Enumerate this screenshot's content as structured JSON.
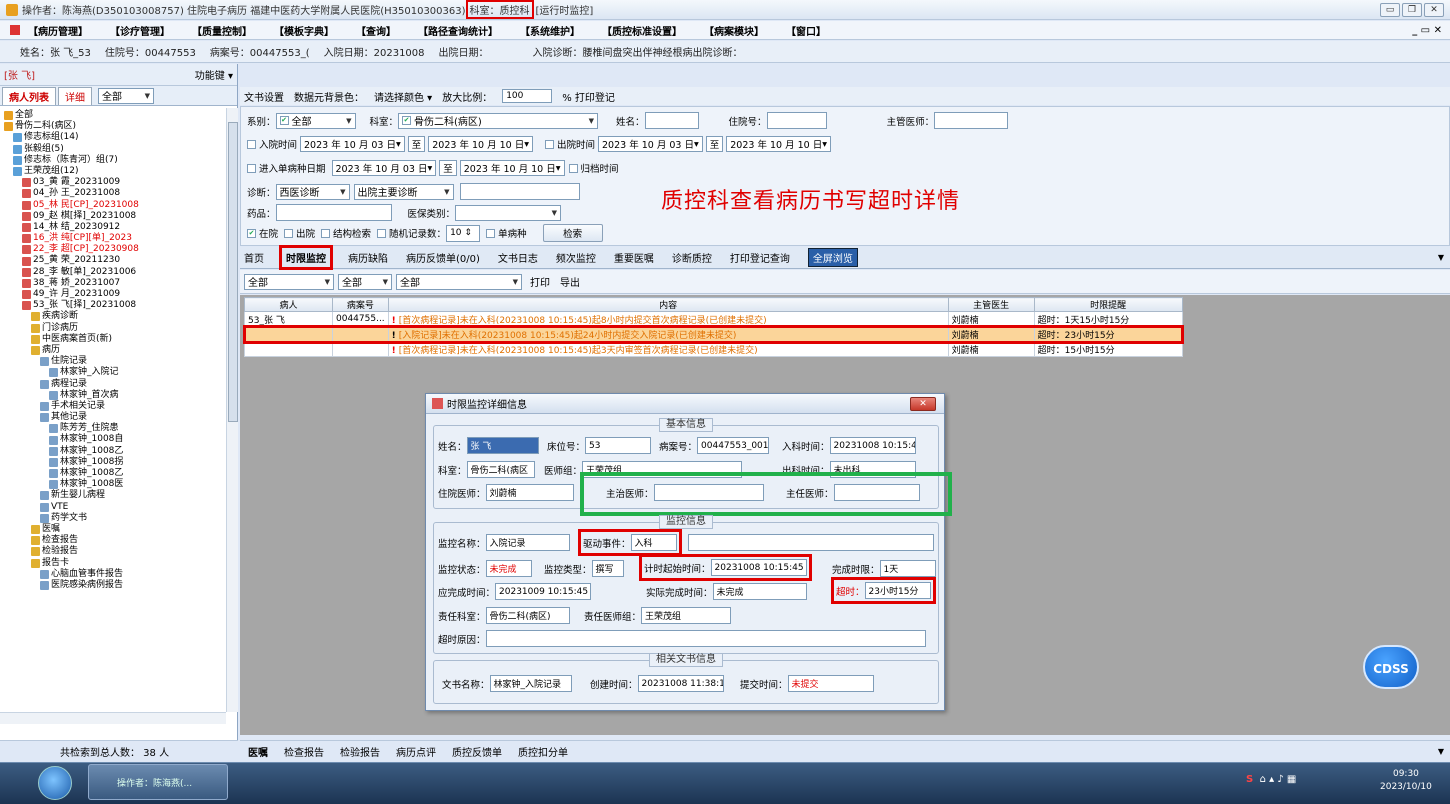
{
  "titlebar": {
    "text": "操作者：陈海燕(D350103008757) 住院电子病历  福建中医药大学附属人民医院(H35010300363)",
    "dept": "科室：质控科",
    "status": "[运行时监控]"
  },
  "menu": [
    "【病历管理】",
    "【诊疗管理】",
    "【质量控制】",
    "【模板字典】",
    "【查询】",
    "【路径查询统计】",
    "【系统维护】",
    "【质控标准设置】",
    "【病案模块】",
    "【窗口】"
  ],
  "patient": {
    "name": "姓名：张  飞_53",
    "inpatient": "住院号：00447553",
    "record": "病案号：00447553_(",
    "admit": "入院日期：20231008",
    "discharge": "出院日期：",
    "diag": "入院诊断：腰椎间盘突出伴神经根病出院诊断："
  },
  "left": {
    "head_name": "[张  飞]",
    "fnkey": "功能键 ▾",
    "tab1": "病人列表",
    "tab2": "详细",
    "scope": "全部",
    "footer": "共检索到总人数：  38  人"
  },
  "tree": [
    {
      "t": "全部",
      "lv": 0,
      "c": ""
    },
    {
      "t": "骨伤二科(病区)",
      "lv": 0,
      "c": ""
    },
    {
      "t": "修志标组(14)",
      "lv": 1,
      "c": ""
    },
    {
      "t": "张毅组(5)",
      "lv": 1,
      "c": ""
    },
    {
      "t": "修志标（陈青河）组(7)",
      "lv": 1,
      "c": ""
    },
    {
      "t": "王荣茂组(12)",
      "lv": 1,
      "c": ""
    },
    {
      "t": "03_黄  霞_20231009",
      "lv": 2,
      "c": ""
    },
    {
      "t": "04_孙  王_20231008",
      "lv": 2,
      "c": ""
    },
    {
      "t": "05_林  民[CP]_20231008",
      "lv": 2,
      "c": "red"
    },
    {
      "t": "09_赵  棋[择]_20231008",
      "lv": 2,
      "c": ""
    },
    {
      "t": "14_林  结_20230912",
      "lv": 2,
      "c": ""
    },
    {
      "t": "16_洪  纯[CP][单]_2023",
      "lv": 2,
      "c": "red"
    },
    {
      "t": "22_李  超[CP]_20230908",
      "lv": 2,
      "c": "red"
    },
    {
      "t": "25_黄  荣_20211230",
      "lv": 2,
      "c": ""
    },
    {
      "t": "28_李  敏[单]_20231006",
      "lv": 2,
      "c": ""
    },
    {
      "t": "38_蒋  娇_20231007",
      "lv": 2,
      "c": ""
    },
    {
      "t": "49_许  月_20231009",
      "lv": 2,
      "c": ""
    },
    {
      "t": "53_张  飞[择]_20231008",
      "lv": 2,
      "c": ""
    },
    {
      "t": "疾病诊断",
      "lv": 3,
      "c": ""
    },
    {
      "t": "门诊病历",
      "lv": 3,
      "c": ""
    },
    {
      "t": "中医病案首页(新)",
      "lv": 3,
      "c": ""
    },
    {
      "t": "病历",
      "lv": 3,
      "c": ""
    },
    {
      "t": "住院记录",
      "lv": 4,
      "c": ""
    },
    {
      "t": "林家钟_入院记",
      "lv": 5,
      "c": ""
    },
    {
      "t": "病程记录",
      "lv": 4,
      "c": ""
    },
    {
      "t": "林家钟_首次病",
      "lv": 5,
      "c": ""
    },
    {
      "t": "手术相关记录",
      "lv": 4,
      "c": ""
    },
    {
      "t": "其他记录",
      "lv": 4,
      "c": ""
    },
    {
      "t": "陈芳芳_住院患",
      "lv": 5,
      "c": ""
    },
    {
      "t": "林家钟_1008自",
      "lv": 5,
      "c": ""
    },
    {
      "t": "林家钟_1008乙",
      "lv": 5,
      "c": ""
    },
    {
      "t": "林家钟_1008拐",
      "lv": 5,
      "c": ""
    },
    {
      "t": "林家钟_1008乙",
      "lv": 5,
      "c": ""
    },
    {
      "t": "林家钟_1008医",
      "lv": 5,
      "c": ""
    },
    {
      "t": "新生婴儿病程",
      "lv": 4,
      "c": ""
    },
    {
      "t": "VTE",
      "lv": 4,
      "c": ""
    },
    {
      "t": "药学文书",
      "lv": 4,
      "c": ""
    },
    {
      "t": "医嘱",
      "lv": 3,
      "c": ""
    },
    {
      "t": "检查报告",
      "lv": 3,
      "c": ""
    },
    {
      "t": "检验报告",
      "lv": 3,
      "c": ""
    },
    {
      "t": "报告卡",
      "lv": 3,
      "c": ""
    },
    {
      "t": "心脑血管事件报告",
      "lv": 4,
      "c": ""
    },
    {
      "t": "医院感染病例报告",
      "lv": 4,
      "c": ""
    }
  ],
  "toolstrip": [
    "文书设置",
    "数据元背景色：",
    "请选择颜色 ▾",
    "放大比例：",
    "100",
    "%  打印登记"
  ],
  "filter": {
    "bie": "系别：",
    "bie_val": "全部",
    "keshi": "科室：",
    "keshi_val": "骨伤二科(病区)",
    "name": "姓名：",
    "zyh": "住院号：",
    "doctor": "主管医师：",
    "admit_lbl": "入院时间",
    "d1": "2023 年 10 月 03 日",
    "to": "至",
    "d2": "2023 年 10 月 10 日",
    "disch_lbl": "出院时间",
    "d3": "2023 年 10 月 03 日",
    "d4": "2023 年 10 月 10 日",
    "single_lbl": "进入单病种日期",
    "d5": "2023 年 10 月 03 日",
    "d6": "2023 年 10 月 10 日",
    "archive": "归档时间",
    "diag_lbl": "诊断：",
    "diag_val": "西医诊断",
    "diag2": "出院主要诊断",
    "drug": "药品：",
    "ins": "医保类别：",
    "c_in": "在院",
    "c_out": "出院",
    "c_struct": "结构检索",
    "c_rand": "随机记录数：",
    "rand_val": "10",
    "c_single": "单病种",
    "search": "检索"
  },
  "banner": "质控科查看病历书写超时详情",
  "navtabs": [
    "首页",
    "时限监控",
    "病历缺陷",
    "病历反馈单(0/0)",
    "文书日志",
    "频次监控",
    "重要医嘱",
    "诊断质控",
    "打印登记查询",
    "全屏浏览"
  ],
  "subtool": {
    "f1": "全部",
    "f2": "全部",
    "f3": "全部",
    "print": "打印",
    "export": "导出"
  },
  "grid": {
    "headers": [
      "病人",
      "病案号",
      "内容",
      "主管医生",
      "时限提醒"
    ],
    "rows": [
      {
        "patient": "53_张  飞",
        "record": "0044755...",
        "content": "[首次病程记录]未在入科(20231008  10:15:45)起8小时内提交首次病程记录(已创建未提交)",
        "doctor": "刘蔚楠",
        "remind": "超时：1天15小时15分"
      },
      {
        "patient": "",
        "record": "",
        "content": "[入院记录]未在入科(20231008  10:15:45)起24小时内提交入院记录(已创建未提交)",
        "doctor": "刘蔚楠",
        "remind": "超时：23小时15分"
      },
      {
        "patient": "",
        "record": "",
        "content": "[首次病程记录]未在入科(20231008  10:15:45)起3天内审签首次病程记录(已创建未提交)",
        "doctor": "刘蔚楠",
        "remind": "超时：15小时15分"
      }
    ]
  },
  "dialog": {
    "title": "时限监控详细信息",
    "g1": "基本信息",
    "name_l": "姓名：",
    "name_v": "张  飞",
    "bed_l": "床位号：",
    "bed_v": "53",
    "rec_l": "病案号：",
    "rec_v": "00447553_001",
    "in_l": "入科时间：",
    "in_v": "20231008 10:15:4",
    "dept_l": "科室：",
    "dept_v": "骨伤二科(病区",
    "grp_l": "医师组：",
    "grp_v": "王荣茂组",
    "out_l": "出科时间：",
    "out_v": "未出科",
    "zy_l": "住院医师：",
    "zy_v": "刘蔚楠",
    "zz_l": "主治医师：",
    "zz_v": "",
    "zr_l": "主任医师：",
    "zr_v": "",
    "g2": "监控信息",
    "mon_l": "监控名称：",
    "mon_v": "入院记录",
    "evt_l": "驱动事件：",
    "evt_v": "入科",
    "st_l": "监控状态：",
    "st_v": "未完成",
    "type_l": "监控类型：",
    "type_v": "撰写",
    "start_l": "计时起始时间：",
    "start_v": "20231008 10:15:45",
    "lim_l": "完成时限：",
    "lim_v": "1天",
    "due_l": "应完成时间：",
    "due_v": "20231009 10:15:45",
    "act_l": "实际完成时间：",
    "act_v": "未完成",
    "over_l": "超时：",
    "over_v": "23小时15分",
    "rd_l": "责任科室：",
    "rd_v": "骨伤二科(病区)",
    "rg_l": "责任医师组：",
    "rg_v": "王荣茂组",
    "why_l": "超时原因：",
    "why_v": "",
    "g3": "相关文书信息",
    "doc_l": "文书名称：",
    "doc_v": "林家钟_入院记录",
    "ct_l": "创建时间：",
    "ct_v": "20231008 11:38:1",
    "sub_l": "提交时间：",
    "sub_v": "未提交"
  },
  "cdss": "CDSS",
  "bottabs": [
    "医嘱",
    "检查报告",
    "检验报告",
    "病历点评",
    "质控反馈单",
    "质控扣分单"
  ],
  "taskbar": {
    "item": "操作者：陈海燕(...",
    "time": "09:30",
    "date": "2023/10/10"
  },
  "colors": {
    "red": "#e00000",
    "green": "#21b14b",
    "highlight": "#fbd59a",
    "orange": "#e07000"
  }
}
